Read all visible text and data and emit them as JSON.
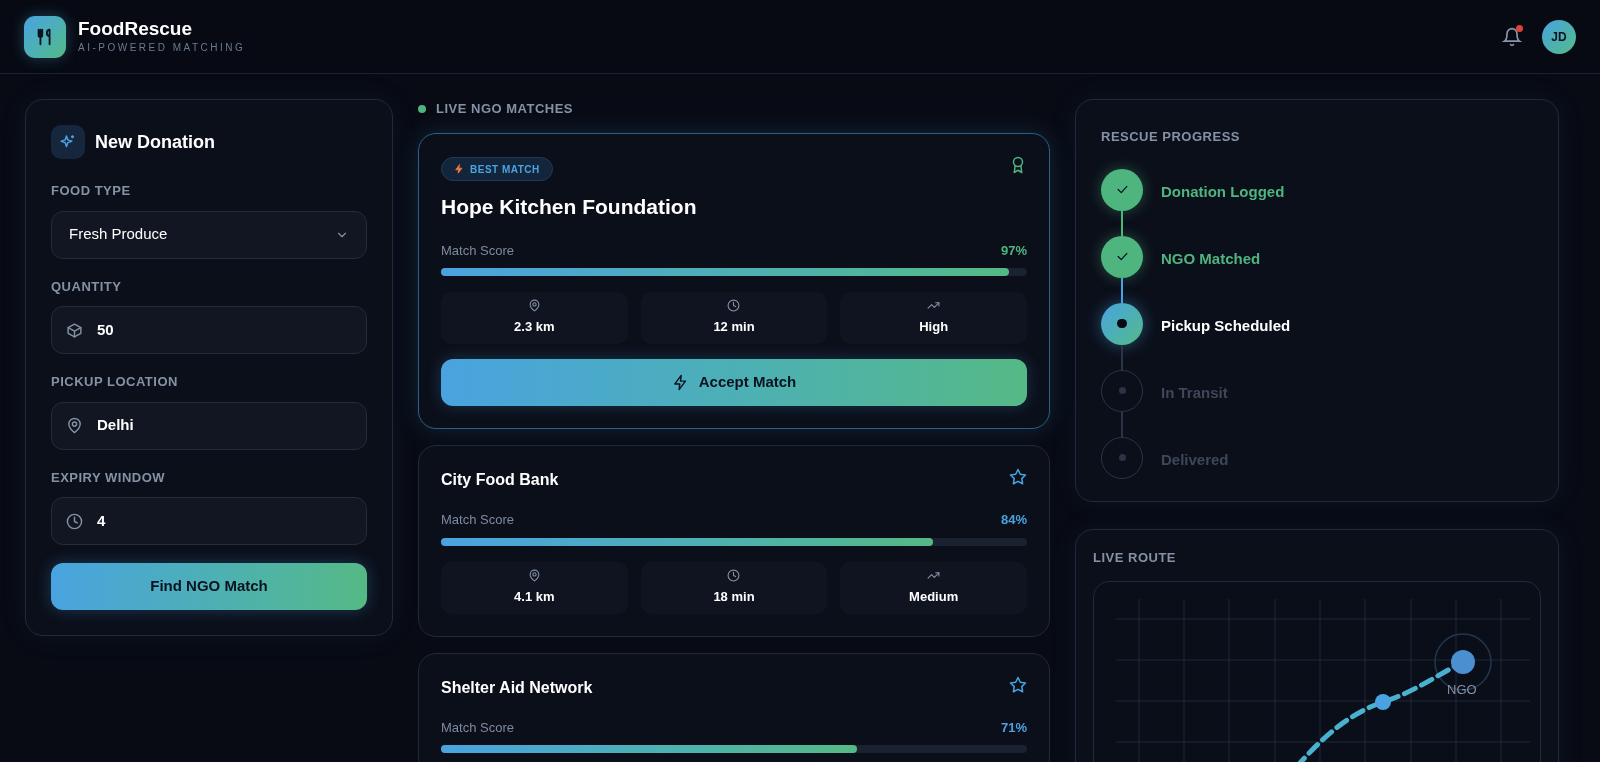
{
  "app": {
    "name": "FoodRescue",
    "tagline": "AI-POWERED MATCHING",
    "avatar": "JD",
    "has_notification": true
  },
  "donation": {
    "title": "New Donation",
    "fields": [
      {
        "kind": "select",
        "label": "FOOD TYPE",
        "value": "Fresh Produce"
      },
      {
        "kind": "quantity",
        "label": "QUANTITY",
        "value": "50"
      },
      {
        "kind": "location",
        "label": "PICKUP LOCATION",
        "value": "Delhi"
      },
      {
        "kind": "time",
        "label": "EXPIRY WINDOW",
        "value": "4"
      }
    ],
    "button": "Find NGO Match"
  },
  "matches": {
    "title": "LIVE NGO MATCHES",
    "items": [
      {
        "kind": "best",
        "badge": "BEST MATCH",
        "name": "Hope Kitchen Foundation",
        "score_label": "Match Score",
        "score": "97%",
        "level": 0.97,
        "distance": "2.3 km",
        "time": "12 min",
        "priority": "High",
        "action": "Accept Match"
      },
      {
        "kind": "standard",
        "name": "City Food Bank",
        "score_label": "Match Score",
        "score": "84%",
        "level": 0.84,
        "distance": "4.1 km",
        "time": "18 min",
        "priority": "Medium"
      },
      {
        "kind": "standard",
        "name": "Shelter Aid Network",
        "score_label": "Match Score",
        "score": "71%",
        "level": 0.71
      }
    ]
  },
  "progress": {
    "title": "RESCUE PROGRESS",
    "steps": [
      {
        "label": "Donation Logged",
        "completed": true,
        "active": false
      },
      {
        "label": "NGO Matched",
        "completed": true,
        "active": false
      },
      {
        "label": "Pickup Scheduled",
        "completed": false,
        "active": true
      },
      {
        "label": "In Transit",
        "completed": false,
        "active": false
      },
      {
        "label": "Delivered",
        "completed": false,
        "active": false
      }
    ]
  },
  "route": {
    "title": "LIVE ROUTE",
    "destination_label": "NGO"
  }
}
